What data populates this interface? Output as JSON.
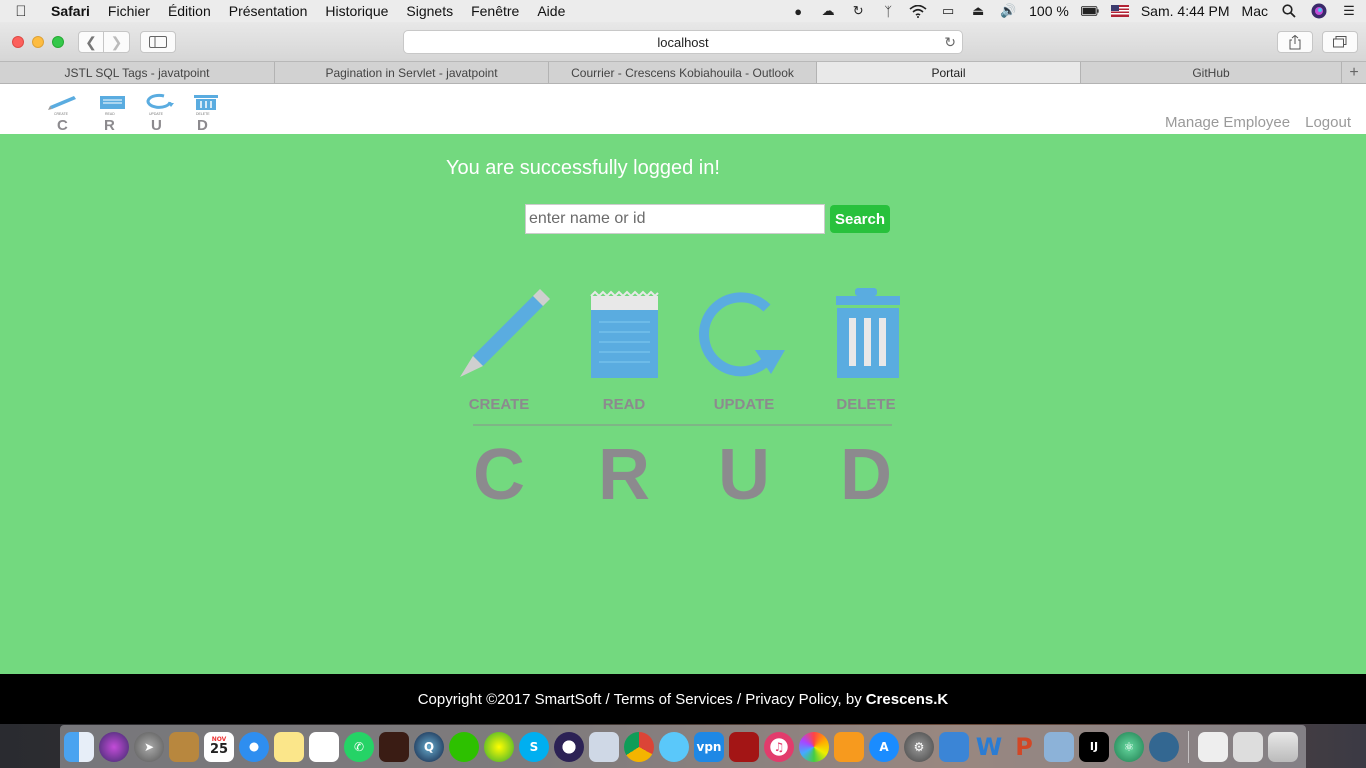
{
  "menubar": {
    "app_name": "Safari",
    "items": [
      "Fichier",
      "Édition",
      "Présentation",
      "Historique",
      "Signets",
      "Fenêtre",
      "Aide"
    ],
    "battery": "100 %",
    "clock": "Sam. 4:44 PM",
    "user": "Mac"
  },
  "browser": {
    "url": "localhost",
    "tabs": [
      {
        "label": "JSTL SQL Tags - javatpoint"
      },
      {
        "label": "Pagination in Servlet - javatpoint"
      },
      {
        "label": "Courrier - Crescens Kobiahouila - Outlook"
      },
      {
        "label": "Portail",
        "active": true
      },
      {
        "label": "GitHub"
      }
    ]
  },
  "header": {
    "logo_letters": [
      "C",
      "R",
      "U",
      "D"
    ],
    "logo_small_labels": [
      "CREATE",
      "READ",
      "UPDATE",
      "DELETE"
    ],
    "nav": {
      "manage_employee": "Manage Employee",
      "logout": "Logout"
    }
  },
  "main": {
    "welcome": "You are successfully logged in!",
    "search": {
      "placeholder": "enter name or id",
      "button": "Search"
    },
    "crud_graphic": {
      "labels": [
        "CREATE",
        "READ",
        "UPDATE",
        "DELETE"
      ],
      "letters": [
        "C",
        "R",
        "U",
        "D"
      ],
      "icons": [
        "pencil-icon",
        "notepad-icon",
        "refresh-icon",
        "trash-icon"
      ]
    }
  },
  "footer": {
    "text": "Copyright ©2017 SmartSoft / Terms of Services / Privacy Policy, by",
    "author": "Crescens.K"
  },
  "dock": {
    "calendar_month": "NOV",
    "calendar_day": "25",
    "apps": [
      "finder-icon",
      "siri-icon",
      "launchpad-icon",
      "contacts-icon",
      "calendar-icon",
      "safari-icon",
      "notes-icon",
      "reminders-icon",
      "whatsapp-icon",
      "bible-icon",
      "quicktime-icon",
      "wechat-icon",
      "app-icon",
      "skype-icon",
      "eclipse-icon",
      "preview-icon",
      "chrome-icon",
      "messages-icon",
      "vpn-icon",
      "photobooth-icon",
      "itunes-icon",
      "photos-icon",
      "ibooks-icon",
      "appstore-icon",
      "system-preferences-icon",
      "xcode-icon",
      "word-icon",
      "powerpoint-icon",
      "utility-icon",
      "intellij-icon",
      "atom-icon",
      "postgres-icon",
      "screenshot-icon",
      "screenshot2-icon",
      "trash-icon"
    ],
    "vpn_label": "vpn",
    "word_label": "W",
    "ppt_label": "P",
    "ij_label": "IJ"
  },
  "colors": {
    "page_green": "#73d97f",
    "search_button": "#28c13c",
    "crud_blue": "#5aace0",
    "crud_gray": "#8c8a8e",
    "footer_bg": "#000000"
  }
}
